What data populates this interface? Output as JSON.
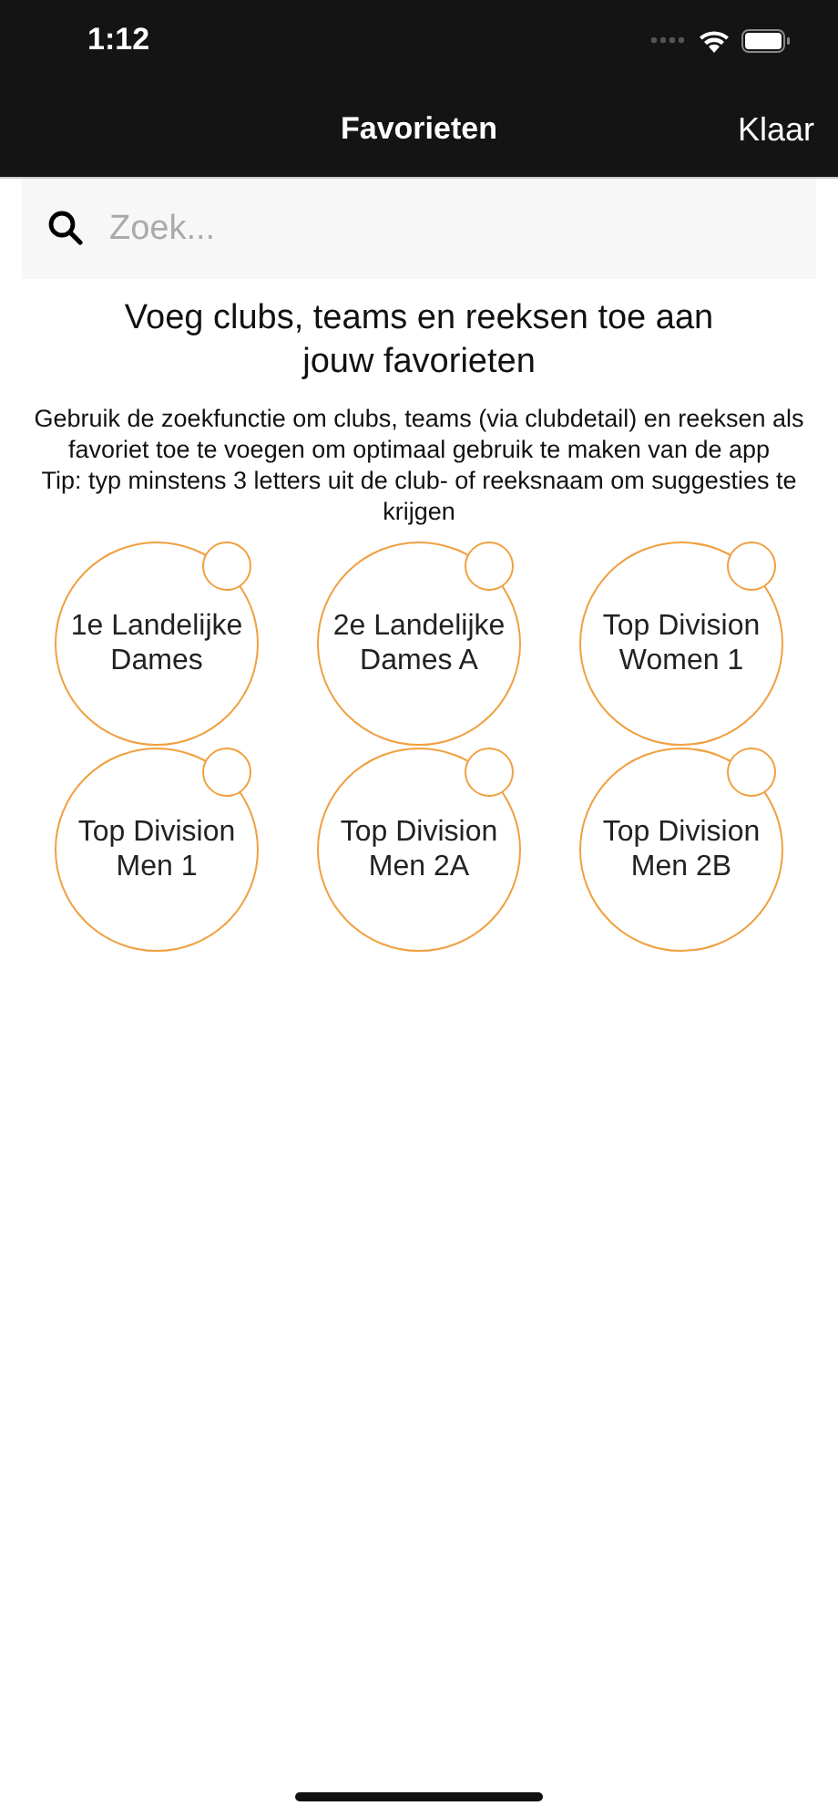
{
  "status_bar": {
    "time": "1:12"
  },
  "nav_bar": {
    "title": "Favorieten",
    "done_button": "Klaar"
  },
  "search": {
    "placeholder": "Zoek..."
  },
  "heading": "Voeg clubs, teams en reeksen toe aan jouw favorieten",
  "description": "Gebruik de zoekfunctie om clubs, teams (via clubdetail) en reeksen als favoriet toe te voegen om optimaal gebruik te maken van de app",
  "tip": "Tip: typ minstens 3 letters uit de club- of reeksnaam om suggesties te krijgen",
  "suggestions": [
    {
      "label": "1e Landelijke Dames"
    },
    {
      "label": "2e Landelijke Dames A"
    },
    {
      "label": "Top Division Women 1"
    },
    {
      "label": "Top Division Men 1"
    },
    {
      "label": "Top Division Men 2A"
    },
    {
      "label": "Top Division Men 2B"
    }
  ]
}
